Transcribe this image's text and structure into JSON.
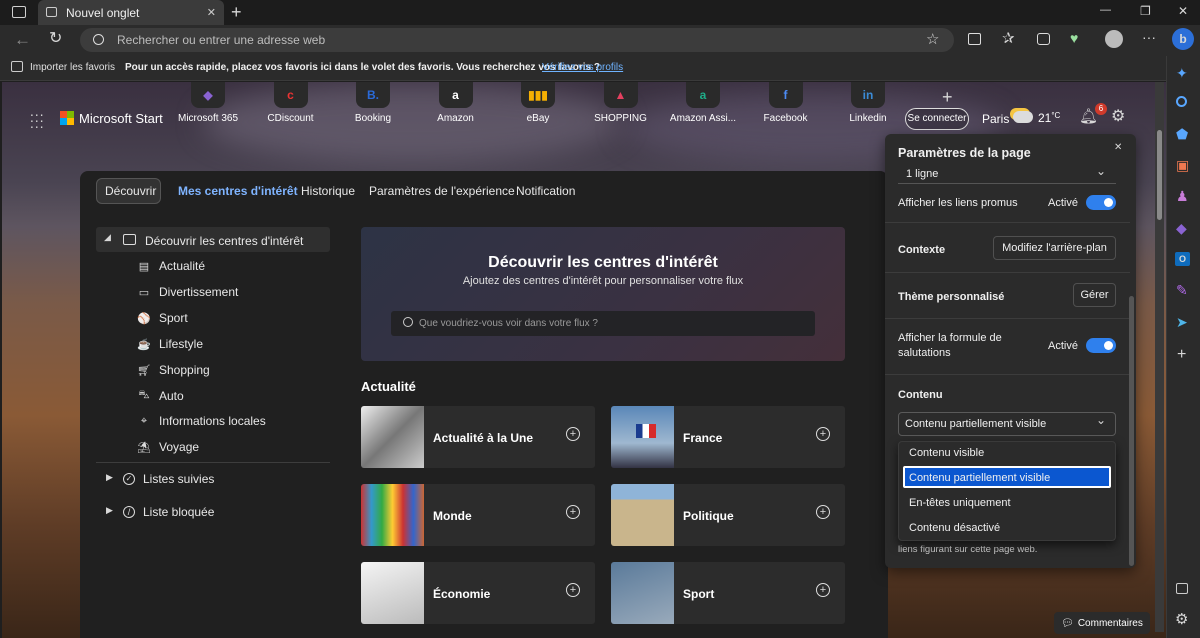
{
  "tab": {
    "title": "Nouvel onglet",
    "close": "✕",
    "new": "+"
  },
  "window": {
    "minimize": "—",
    "restore": "❐",
    "close": "✕"
  },
  "address": {
    "placeholder": "Rechercher ou entrer une adresse web"
  },
  "favbar": {
    "import": "Importer les favoris",
    "message": "Pour un accès rapide, placez vos favoris ici dans le volet des favoris. Vous recherchez vos favoris ?",
    "link": "Vérifiez vos profils"
  },
  "brand": {
    "name": "Microsoft Start"
  },
  "quicklinks": [
    {
      "label": "Microsoft 365",
      "glyph": "◆",
      "color": "#8a63d2"
    },
    {
      "label": "CDiscount",
      "glyph": "c",
      "color": "#e33"
    },
    {
      "label": "Booking",
      "glyph": "B.",
      "color": "#2a6ad8"
    },
    {
      "label": "Amazon",
      "glyph": "a",
      "color": "#fff"
    },
    {
      "label": "eBay",
      "glyph": "▮▮▮",
      "color": "#f5af02"
    },
    {
      "label": "SHOPPING",
      "glyph": "▲",
      "color": "#e4405f"
    },
    {
      "label": "Amazon Assi...",
      "glyph": "a",
      "color": "#1fae8a"
    },
    {
      "label": "Facebook",
      "glyph": "f",
      "color": "#4d8cf5"
    },
    {
      "label": "Linkedin",
      "glyph": "in",
      "color": "#3b8bd6"
    }
  ],
  "header": {
    "signin": "Se connecter",
    "city": "Paris",
    "temp": "21",
    "unit": "°C",
    "badge": "6"
  },
  "nav": {
    "tabs": [
      "Découvrir",
      "Mes centres d'intérêt",
      "Historique",
      "Paramètres de l'expérience",
      "Notification"
    ]
  },
  "tree": {
    "root": "Découvrir les centres d'intérêt",
    "items": [
      "Actualité",
      "Divertissement",
      "Sport",
      "Lifestyle",
      "Shopping",
      "Auto",
      "Informations locales",
      "Voyage"
    ],
    "followed": "Listes suivies",
    "blocked": "Liste bloquée"
  },
  "hero": {
    "title": "Découvrir les centres d'intérêt",
    "subtitle": "Ajoutez des centres d'intérêt pour personnaliser votre flux",
    "search_placeholder": "Que voudriez-vous voir dans votre flux ?"
  },
  "section": {
    "title": "Actualité"
  },
  "cards": [
    "Actualité à la Une",
    "France",
    "Monde",
    "Politique",
    "Économie",
    "Sport"
  ],
  "settings": {
    "title": "Paramètres de la page",
    "lines": "1 ligne",
    "promo_label": "Afficher les liens promus",
    "promo_state": "Activé",
    "context_label": "Contexte",
    "context_button": "Modifiez l'arrière-plan",
    "theme_label": "Thème personnalisé",
    "theme_button": "Gérer",
    "greeting_label_1": "Afficher la formule de",
    "greeting_label_2": "salutations",
    "greeting_state": "Activé",
    "content_label": "Contenu",
    "content_value": "Contenu partiellement visible",
    "footer_note": "liens figurant sur cette page web.",
    "options": [
      "Contenu visible",
      "Contenu partiellement visible",
      "En-têtes uniquement",
      "Contenu désactivé"
    ]
  },
  "comments": {
    "label": "Commentaires"
  }
}
